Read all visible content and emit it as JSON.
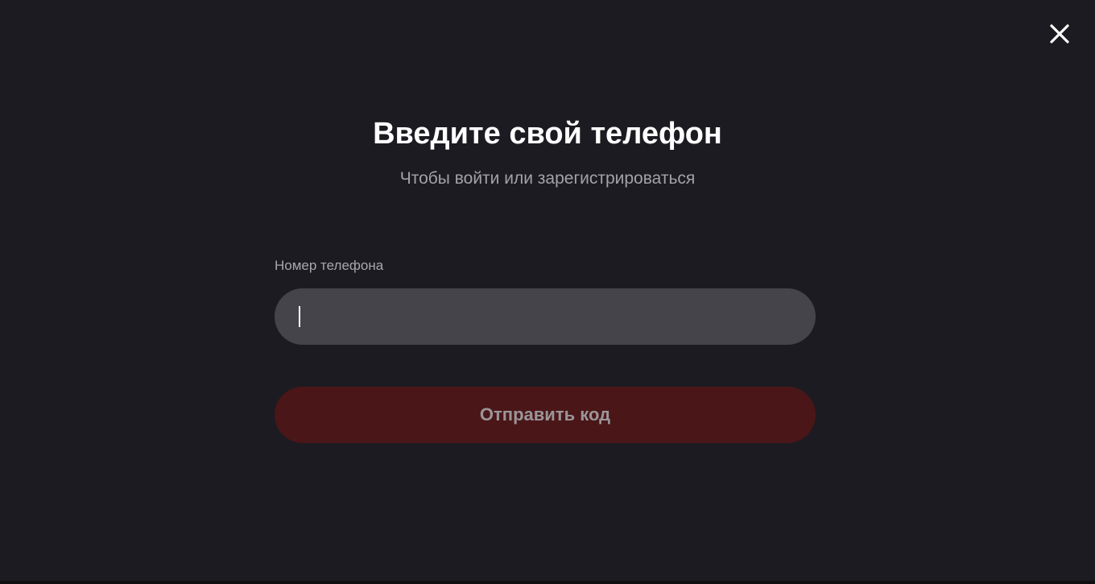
{
  "dialog": {
    "title": "Введите свой телефон",
    "subtitle": "Чтобы войти или зарегистрироваться",
    "close_icon": "close-icon"
  },
  "form": {
    "phone_label": "Номер телефона",
    "phone_value": "",
    "phone_placeholder": "",
    "submit_label": "Отправить код"
  },
  "colors": {
    "background": "#1c1b21",
    "input_background": "#45444b",
    "button_background_disabled": "#4a1618",
    "button_text_disabled": "#9a9599",
    "title_text": "#ffffff",
    "muted_text": "#a3a2a8"
  }
}
